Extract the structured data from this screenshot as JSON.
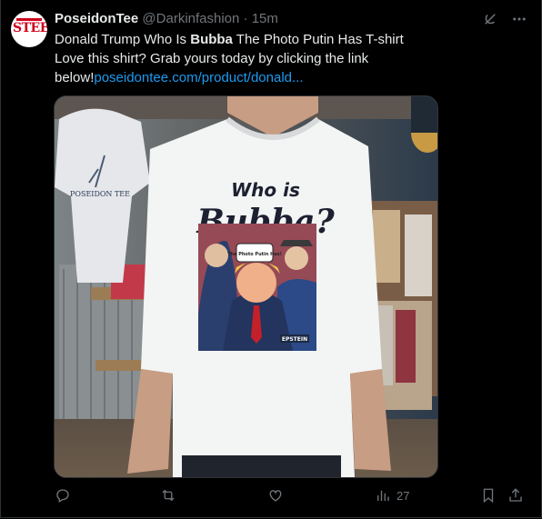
{
  "tweet": {
    "avatar_text": "STEES",
    "display_name": "PoseidonTee",
    "handle": "@Darkinfashion",
    "separator": "·",
    "time": "15m",
    "text_line1_pre": "Donald Trump Who Is ",
    "text_line1_bold": "Bubba",
    "text_line1_post": " The Photo Putin Has T-shirt",
    "text_line2": "Love this shirt? Grab yours today by clicking the link",
    "text_line3_pre": "below!",
    "text_link": "poseidontee.com/product/donald..."
  },
  "image": {
    "shirt_headline_1": "Who is",
    "shirt_headline_2": "Bubba?",
    "speech_bubble": "The Photo Putin Has!",
    "badge_text": "EPSTEIN",
    "background_shirt_brand": "POSEIDON TEE"
  },
  "actions": {
    "reply_count": "",
    "retweet_count": "",
    "like_count": "",
    "views_count": "27"
  },
  "icons": {
    "grok": "grok-icon",
    "more": "more-icon",
    "reply": "reply-icon",
    "retweet": "retweet-icon",
    "like": "like-icon",
    "views": "views-icon",
    "bookmark": "bookmark-icon",
    "share": "share-icon"
  }
}
